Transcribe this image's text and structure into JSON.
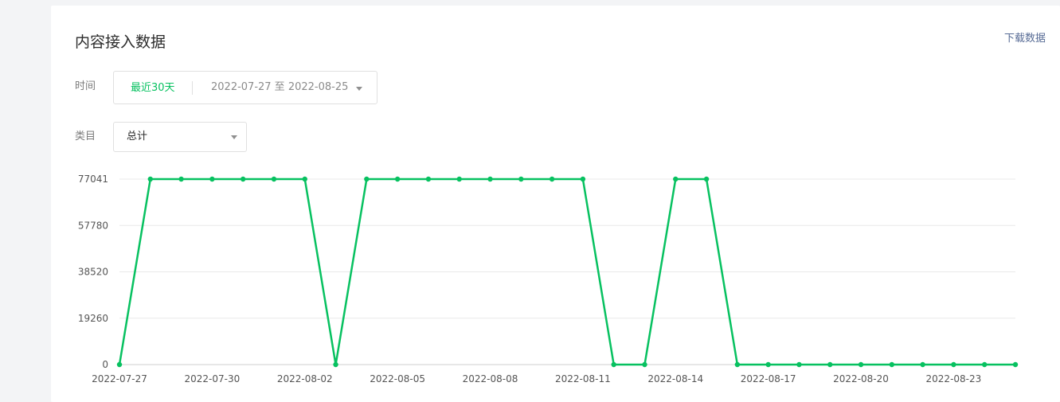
{
  "header": {
    "title": "内容接入数据",
    "download_label": "下载数据"
  },
  "filters": {
    "time_label": "时间",
    "date_quick_range": "最近30天",
    "date_range": "2022-07-27 至 2022-08-25",
    "category_label": "类目",
    "category_value": "总计"
  },
  "colors": {
    "accent": "#07c160",
    "link": "#576b95"
  },
  "icons": {
    "dropdown": "caret-down-icon"
  },
  "chart_data": {
    "type": "line",
    "ylim": [
      0,
      77041
    ],
    "yticks": [
      0,
      19260,
      38520,
      57780,
      77041
    ],
    "grid": true,
    "x": [
      "2022-07-27",
      "2022-07-28",
      "2022-07-29",
      "2022-07-30",
      "2022-07-31",
      "2022-08-01",
      "2022-08-02",
      "2022-08-03",
      "2022-08-04",
      "2022-08-05",
      "2022-08-06",
      "2022-08-07",
      "2022-08-08",
      "2022-08-09",
      "2022-08-10",
      "2022-08-11",
      "2022-08-12",
      "2022-08-13",
      "2022-08-14",
      "2022-08-15",
      "2022-08-16",
      "2022-08-17",
      "2022-08-18",
      "2022-08-19",
      "2022-08-20",
      "2022-08-21",
      "2022-08-22",
      "2022-08-23",
      "2022-08-24",
      "2022-08-25"
    ],
    "xtick_labels": [
      "2022-07-27",
      "2022-07-30",
      "2022-08-02",
      "2022-08-05",
      "2022-08-08",
      "2022-08-11",
      "2022-08-14",
      "2022-08-17",
      "2022-08-20",
      "2022-08-23"
    ],
    "series": [
      {
        "color": "#07c160",
        "values": [
          0,
          77041,
          77041,
          77041,
          77041,
          77041,
          77041,
          0,
          77041,
          77041,
          77041,
          77041,
          77041,
          77041,
          77041,
          77041,
          0,
          0,
          77041,
          77041,
          0,
          0,
          0,
          0,
          0,
          0,
          0,
          0,
          0,
          0
        ]
      }
    ]
  }
}
